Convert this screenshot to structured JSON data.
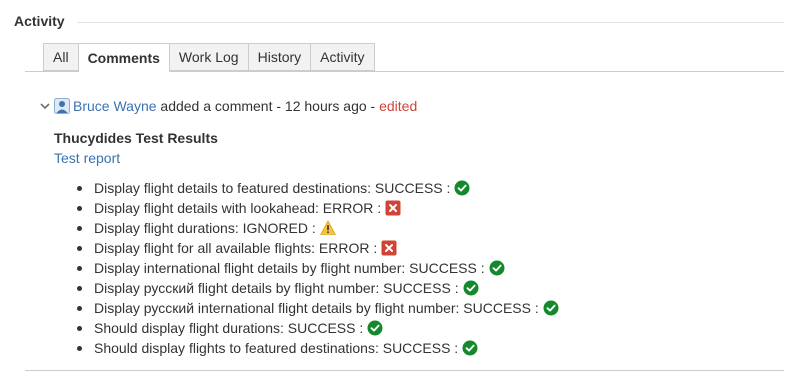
{
  "section": {
    "title": "Activity"
  },
  "tabs": [
    {
      "label": "All",
      "active": false
    },
    {
      "label": "Comments",
      "active": true
    },
    {
      "label": "Work Log",
      "active": false
    },
    {
      "label": "History",
      "active": false
    },
    {
      "label": "Activity",
      "active": false
    }
  ],
  "comment": {
    "author": "Bruce Wayne",
    "action": " added a comment - ",
    "time": "12 hours ago",
    "separator": " - ",
    "edited": "edited",
    "heading": "Thucydides Test Results",
    "report_link": "Test report",
    "results": [
      {
        "text": "Display flight details to featured destinations: SUCCESS :",
        "status": "success"
      },
      {
        "text": "Display flight details with lookahead: ERROR :",
        "status": "error"
      },
      {
        "text": "Display flight durations: IGNORED :",
        "status": "warning"
      },
      {
        "text": "Display flight for all available flights: ERROR :",
        "status": "error"
      },
      {
        "text": "Display international flight details by flight number: SUCCESS :",
        "status": "success"
      },
      {
        "text": "Display русский flight details by flight number: SUCCESS :",
        "status": "success"
      },
      {
        "text": "Display русский international flight details by flight number: SUCCESS :",
        "status": "success"
      },
      {
        "text": "Should display flight durations: SUCCESS :",
        "status": "success"
      },
      {
        "text": "Should display flights to featured destinations: SUCCESS :",
        "status": "success"
      }
    ]
  },
  "icons": {
    "success": "check-circle-icon",
    "error": "error-x-icon",
    "warning": "warning-triangle-icon"
  },
  "colors": {
    "link": "#3b73af",
    "edited": "#d04437",
    "success": "#14892c",
    "error": "#d04437",
    "warning": "#f6c342"
  }
}
